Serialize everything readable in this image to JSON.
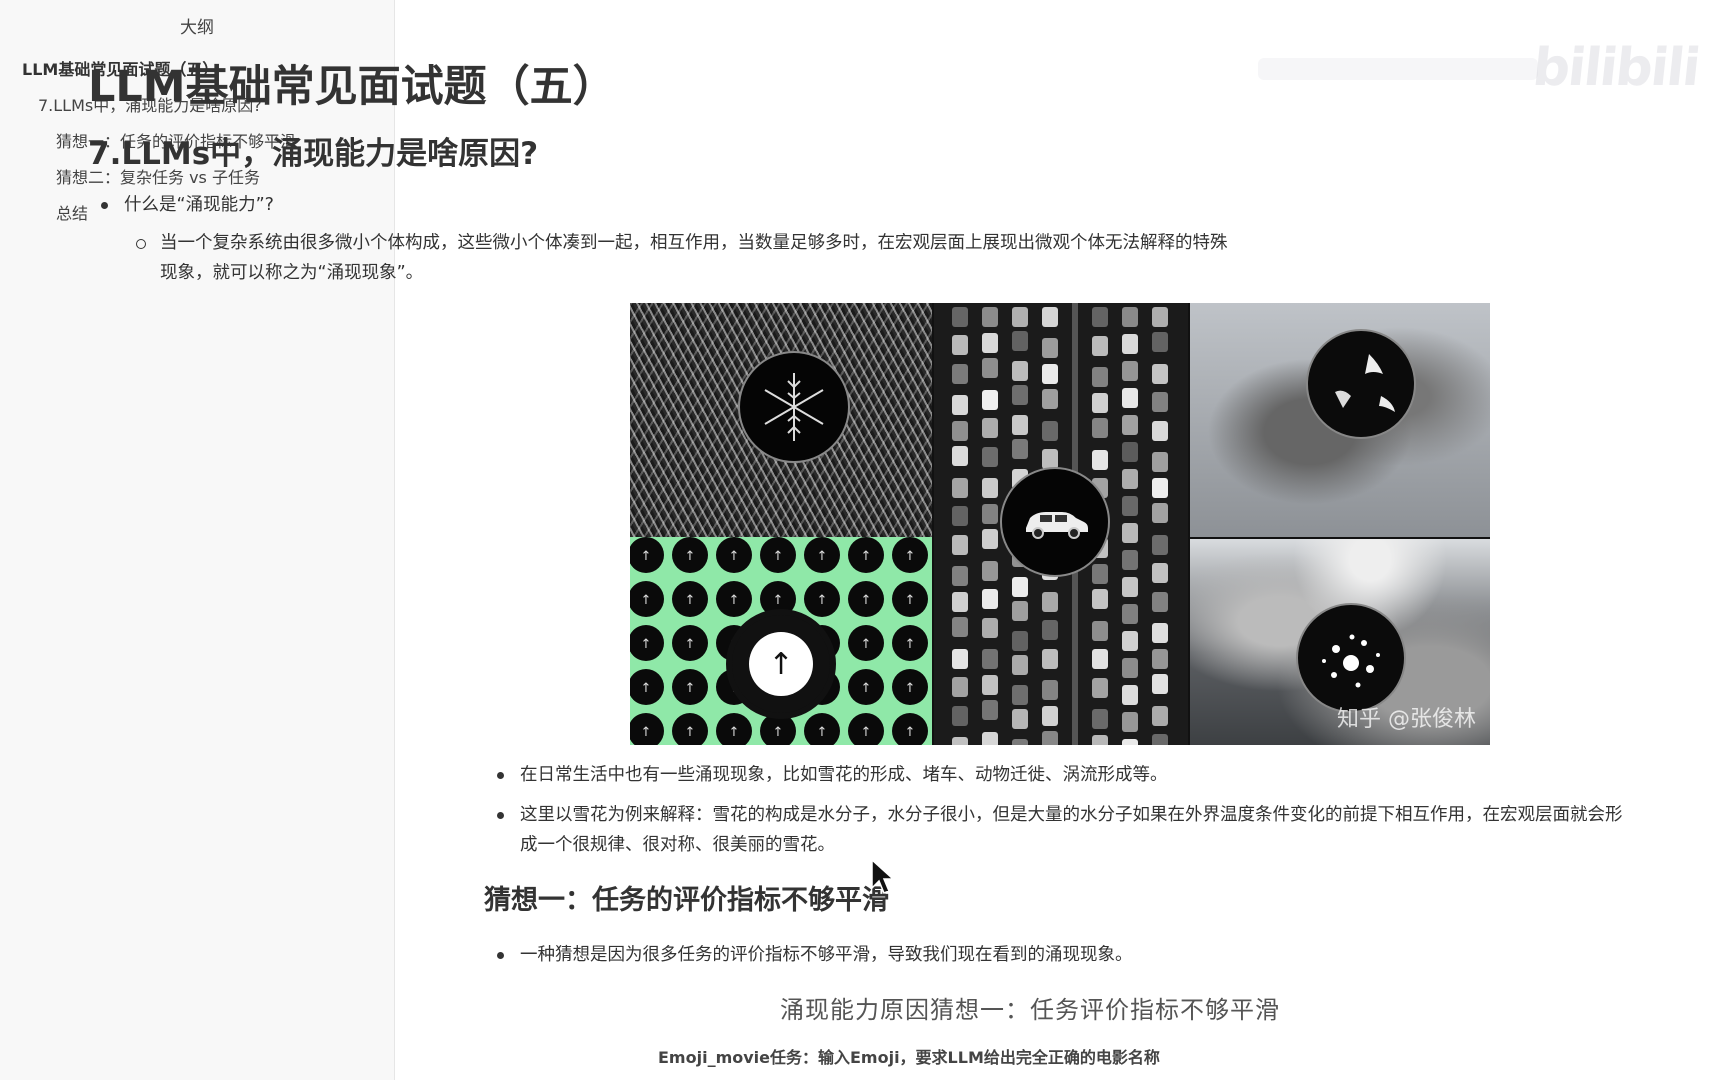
{
  "sidebar": {
    "title": "大纲",
    "items": [
      {
        "label": "LLM基础常见面试题（五）",
        "level": 1
      },
      {
        "label": "7.LLMs中，涌现能力是啥原因?",
        "level": 2
      },
      {
        "label": "猜想一：任务的评价指标不够平滑",
        "level": 3
      },
      {
        "label": "猜想二：复杂任务 vs 子任务",
        "level": 3
      },
      {
        "label": "总结",
        "level": 3
      }
    ]
  },
  "doc": {
    "title": "LLM基础常见面试题（五）",
    "section": "7.LLMs中，涌现能力是啥原因?",
    "bullet1": "什么是“涌现能力”?",
    "bullet1_sub": "当一个复杂系统由很多微小个体构成，这些微小个体凑到一起，相互作用，当数量足够多时，在宏观层面上展现出微观个体无法解释的特殊现象，就可以称之为“涌现现象”。",
    "figure_watermark": "知乎 @张俊林",
    "bullet2": "在日常生活中也有一些涌现现象，比如雪花的形成、堵车、动物迁徙、涡流形成等。",
    "bullet3": "这里以雪花为例来解释：雪花的构成是水分子，水分子很小，但是大量的水分子如果在外界温度条件变化的前提下相互作用，在宏观层面就会形成一个很规律、很对称、很美丽的雪花。",
    "subsection": "猜想一：任务的评价指标不够平滑",
    "bullet4": "一种猜想是因为很多任务的评价指标不够平滑，导致我们现在看到的涌现现象。",
    "slide_title": "涌现能力原因猜想一：任务评价指标不够平滑",
    "slide_subtitle": "Emoji_movie任务：输入Emoji，要求LLM给出完全正确的电影名称"
  },
  "watermark": "bilibili",
  "colors": {
    "sidebar_bg": "#f8f8f8",
    "text": "#333333",
    "figure_green": "#8fe8a8"
  }
}
